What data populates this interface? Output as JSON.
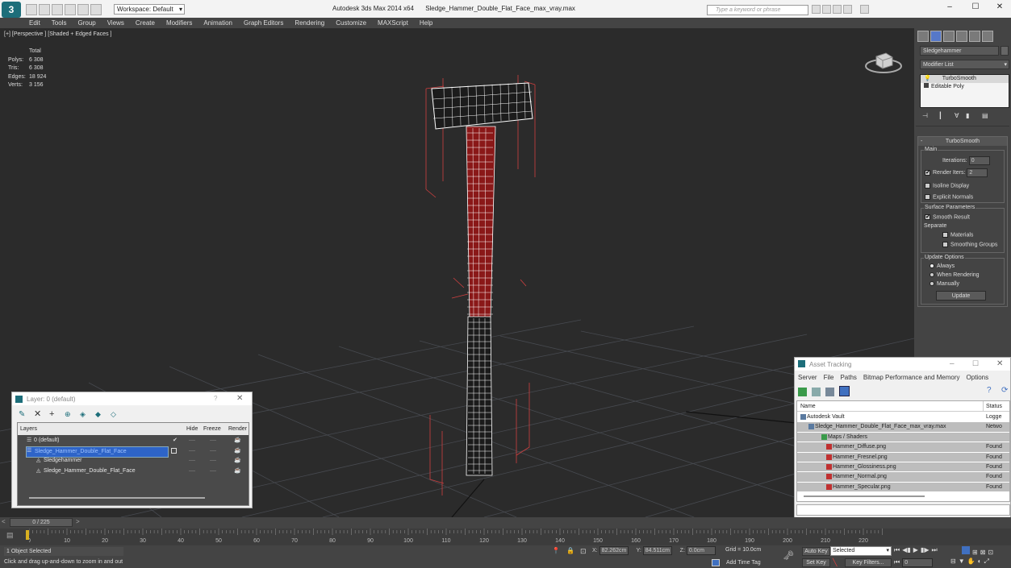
{
  "title": {
    "workspace_label": "Workspace: Default",
    "app": "Autodesk 3ds Max  2014 x64",
    "file": "Sledge_Hammer_Double_Flat_Face_max_vray.max",
    "search_placeholder": "Type a keyword or phrase"
  },
  "menu": [
    "Edit",
    "Tools",
    "Group",
    "Views",
    "Create",
    "Modifiers",
    "Animation",
    "Graph Editors",
    "Rendering",
    "Customize",
    "MAXScript",
    "Help"
  ],
  "viewport": {
    "label": "[+] [Perspective ] [Shaded + Edged Faces ]",
    "stats": {
      "header": "Total",
      "rows": [
        {
          "label": "Polys:",
          "value": "6 308"
        },
        {
          "label": "Tris:",
          "value": "6 308"
        },
        {
          "label": "Edges:",
          "value": "18 924"
        },
        {
          "label": "Verts:",
          "value": "3 156"
        }
      ]
    }
  },
  "command_panel": {
    "object_name": "Sledgehammer",
    "modifier_list": "Modifier List",
    "stack": [
      "TurboSmooth",
      "Editable Poly"
    ],
    "rollout_title": "TurboSmooth",
    "main_label": "Main",
    "iterations_label": "Iterations:",
    "iterations_value": "0",
    "render_iters_label": "Render Iters:",
    "render_iters_value": "2",
    "isoline": "Isoline Display",
    "explicit": "Explicit Normals",
    "surface_label": "Surface Parameters",
    "smooth_result": "Smooth Result",
    "separate": "Separate",
    "materials": "Materials",
    "smoothing_groups": "Smoothing Groups",
    "update_label": "Update Options",
    "always": "Always",
    "when_rendering": "When Rendering",
    "manually": "Manually",
    "update_button": "Update"
  },
  "layer_dialog": {
    "title": "Layer: 0 (default)",
    "help": "?",
    "col_layers": "Layers",
    "col_hide": "Hide",
    "col_freeze": "Freeze",
    "col_render": "Render",
    "rows": [
      {
        "name": "0 (default)"
      },
      {
        "name": "Sledge_Hammer_Double_Flat_Face"
      },
      {
        "name": "Sledgehammer"
      },
      {
        "name": "Sledge_Hammer_Double_Flat_Face"
      }
    ],
    "dash": "----"
  },
  "asset_dialog": {
    "title": "Asset Tracking",
    "menu": [
      "Server",
      "File",
      "Paths",
      "Bitmap Performance and Memory",
      "Options"
    ],
    "col_name": "Name",
    "col_status": "Status",
    "rows": [
      {
        "name": "Autodesk Vault",
        "status": "Logge"
      },
      {
        "name": "Sledge_Hammer_Double_Flat_Face_max_vray.max",
        "status": "Netwo"
      },
      {
        "name": "Maps / Shaders",
        "status": ""
      },
      {
        "name": "Hammer_Diffuse.png",
        "status": "Found"
      },
      {
        "name": "Hammer_Fresnel.png",
        "status": "Found"
      },
      {
        "name": "Hammer_Glossiness.png",
        "status": "Found"
      },
      {
        "name": "Hammer_Normal.png",
        "status": "Found"
      },
      {
        "name": "Hammer_Specular.png",
        "status": "Found"
      }
    ]
  },
  "timeline": {
    "frame": "0 / 225",
    "ticks": [
      "0",
      "10",
      "20",
      "30",
      "40",
      "50",
      "60",
      "70",
      "80",
      "90",
      "100",
      "110",
      "120",
      "130",
      "140",
      "150",
      "160",
      "170",
      "180",
      "190",
      "200",
      "210",
      "220"
    ]
  },
  "status": {
    "selected": "1 Object Selected",
    "prompt": "Click and drag up-and-down to zoom in and out",
    "x_label": "X:",
    "x": "82.262cm",
    "y_label": "Y:",
    "y": "84.511cm",
    "z_label": "Z:",
    "z": "0.0cm",
    "grid": "Grid = 10.0cm",
    "add_time_tag": "Add Time Tag",
    "auto_key": "Auto Key",
    "selected_dropdown": "Selected",
    "set_key": "Set Key",
    "key_filters": "Key Filters...",
    "frame_field": "0"
  }
}
